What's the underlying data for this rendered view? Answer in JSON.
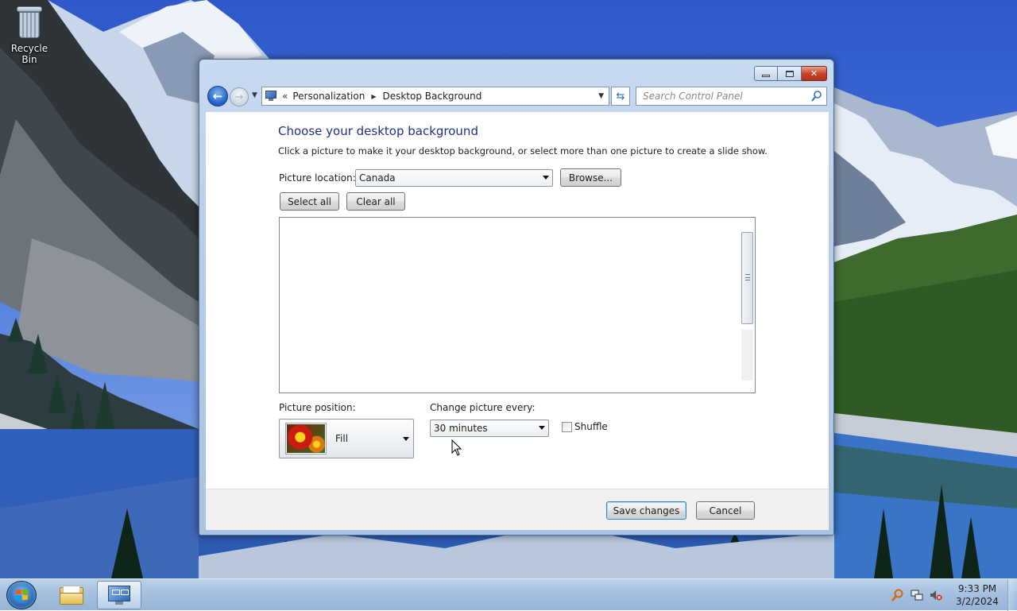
{
  "desktop": {
    "icons": [
      {
        "label": "Recycle Bin",
        "icon": "recycle-bin-icon"
      }
    ]
  },
  "window": {
    "controls": {
      "minimize": "minimize",
      "maximize": "maximize",
      "close": "close"
    },
    "nav": {
      "back_icon": "back-arrow-icon",
      "forward_icon": "forward-arrow-icon",
      "breadcrumb_overflow": "«",
      "breadcrumb": [
        "Personalization",
        "Desktop Background"
      ],
      "search_placeholder": "Search Control Panel"
    },
    "content": {
      "title": "Choose your desktop background",
      "subtitle": "Click a picture to make it your desktop background, or select more than one picture to create a slide show.",
      "picture_location_label": "Picture location:",
      "picture_location_value": "Canada",
      "browse_label": "Browse...",
      "select_all_label": "Select all",
      "clear_all_label": "Clear all",
      "picture_position_label": "Picture position:",
      "picture_position_value": "Fill",
      "change_picture_label": "Change picture every:",
      "change_picture_value": "30 minutes",
      "shuffle_label": "Shuffle",
      "shuffle_checked": false
    },
    "footer": {
      "save_label": "Save changes",
      "cancel_label": "Cancel"
    }
  },
  "taskbar": {
    "pinned": [
      {
        "name": "windows-explorer",
        "icon": "folder-icon",
        "active": false
      },
      {
        "name": "control-panel",
        "icon": "control-panel-icon",
        "active": true
      }
    ],
    "tray_icons": [
      "action-center-icon",
      "network-icon",
      "volume-muted-icon"
    ],
    "clock": {
      "time": "9:33 PM",
      "date": "3/2/2024"
    }
  },
  "colors": {
    "title_blue": "#1e3287",
    "taskbar": "#a6c0de",
    "window_frame": "#b7cde8"
  }
}
